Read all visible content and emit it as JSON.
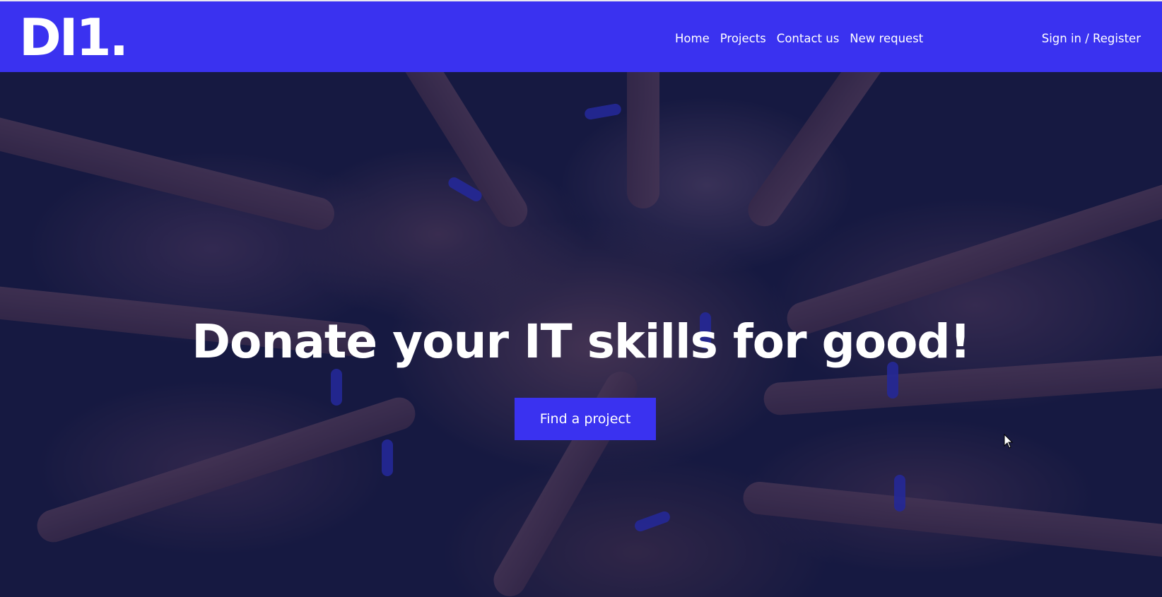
{
  "brand": {
    "logo_text": "DI1."
  },
  "nav": {
    "links": [
      {
        "label": "Home"
      },
      {
        "label": "Projects"
      },
      {
        "label": "Contact us"
      },
      {
        "label": "New request"
      }
    ],
    "signin_label": "Sign in / Register"
  },
  "hero": {
    "headline": "Donate your IT skills for good!",
    "cta_label": "Find a project"
  },
  "colors": {
    "accent": "#3a32f0",
    "text_on_accent": "#ffffff"
  }
}
